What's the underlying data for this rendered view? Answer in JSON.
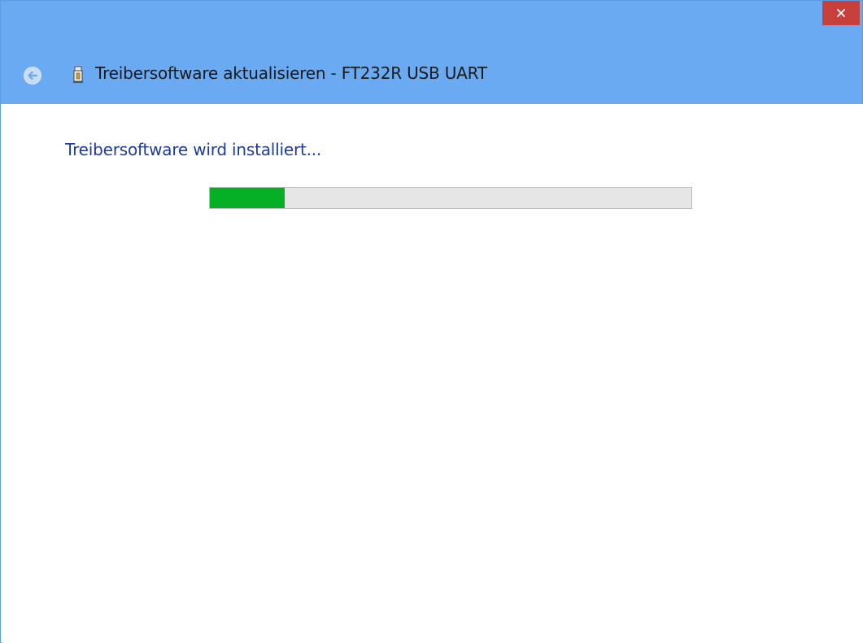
{
  "window": {
    "title": "Treibersoftware aktualisieren - FT232R USB UART",
    "close_label": "×"
  },
  "icons": {
    "back": "back-arrow-icon",
    "device": "usb-device-icon",
    "close": "close-icon"
  },
  "content": {
    "heading": "Treibersoftware wird installiert...",
    "progress": {
      "fraction": 0.155
    }
  },
  "colors": {
    "titlebar": "#6aaaf2",
    "close_button": "#c7403c",
    "heading_text": "#1e3c9c",
    "progress_fill": "#06b025",
    "progress_track": "#e6e6e6"
  }
}
